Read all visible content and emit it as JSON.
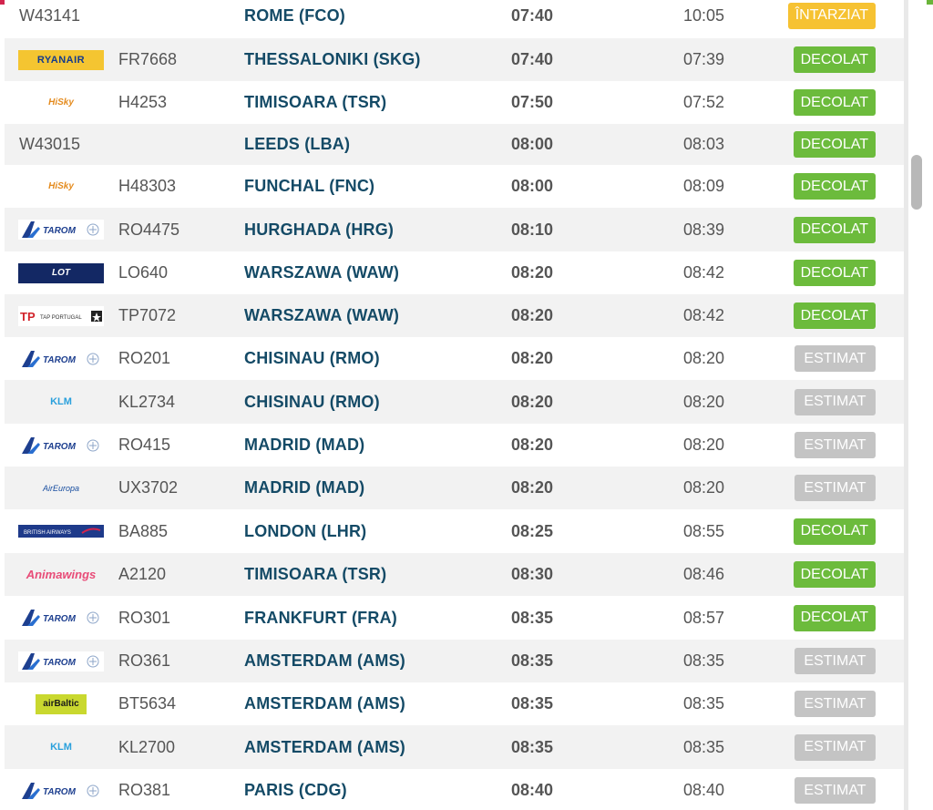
{
  "colors": {
    "topbar": [
      "#d2244d",
      "#8b2a82",
      "#6ab43a"
    ],
    "destination": "#144a66",
    "status_decolat": "#6cbb3c",
    "status_estimat": "#c4c4c4",
    "status_intarziat": "#f6c232"
  },
  "flights": [
    {
      "airline_icon": "none",
      "airline_text": "",
      "flight": "W43141",
      "destination": "ROME (FCO)",
      "scheduled": "07:40",
      "estimated": "10:05",
      "status": "ÎNTARZIAT",
      "status_type": "intarziat"
    },
    {
      "airline_icon": "ryanair-logo-icon",
      "airline_text": "RYANAIR",
      "flight": "FR7668",
      "destination": "THESSALONIKI (SKG)",
      "scheduled": "07:40",
      "estimated": "07:39",
      "status": "DECOLAT",
      "status_type": "decolat"
    },
    {
      "airline_icon": "hisky-logo-icon",
      "airline_text": "HiSky",
      "flight": "H4253",
      "destination": "TIMISOARA (TSR)",
      "scheduled": "07:50",
      "estimated": "07:52",
      "status": "DECOLAT",
      "status_type": "decolat"
    },
    {
      "airline_icon": "none",
      "airline_text": "",
      "flight": "W43015",
      "destination": "LEEDS (LBA)",
      "scheduled": "08:00",
      "estimated": "08:03",
      "status": "DECOLAT",
      "status_type": "decolat"
    },
    {
      "airline_icon": "hisky-logo-icon",
      "airline_text": "HiSky",
      "flight": "H48303",
      "destination": "FUNCHAL (FNC)",
      "scheduled": "08:00",
      "estimated": "08:09",
      "status": "DECOLAT",
      "status_type": "decolat"
    },
    {
      "airline_icon": "tarom-logo-icon",
      "airline_text": "TAROM",
      "flight": "RO4475",
      "destination": "HURGHADA (HRG)",
      "scheduled": "08:10",
      "estimated": "08:39",
      "status": "DECOLAT",
      "status_type": "decolat"
    },
    {
      "airline_icon": "lot-logo-icon",
      "airline_text": "LOT",
      "flight": "LO640",
      "destination": "WARSZAWA (WAW)",
      "scheduled": "08:20",
      "estimated": "08:42",
      "status": "DECOLAT",
      "status_type": "decolat"
    },
    {
      "airline_icon": "tap-logo-icon",
      "airline_text": "TAP PORTUGAL",
      "flight": "TP7072",
      "destination": "WARSZAWA (WAW)",
      "scheduled": "08:20",
      "estimated": "08:42",
      "status": "DECOLAT",
      "status_type": "decolat"
    },
    {
      "airline_icon": "tarom-logo-icon",
      "airline_text": "TAROM",
      "flight": "RO201",
      "destination": "CHISINAU (RMO)",
      "scheduled": "08:20",
      "estimated": "08:20",
      "status": "ESTIMAT",
      "status_type": "estimat"
    },
    {
      "airline_icon": "klm-logo-icon",
      "airline_text": "KLM",
      "flight": "KL2734",
      "destination": "CHISINAU (RMO)",
      "scheduled": "08:20",
      "estimated": "08:20",
      "status": "ESTIMAT",
      "status_type": "estimat"
    },
    {
      "airline_icon": "tarom-logo-icon",
      "airline_text": "TAROM",
      "flight": "RO415",
      "destination": "MADRID (MAD)",
      "scheduled": "08:20",
      "estimated": "08:20",
      "status": "ESTIMAT",
      "status_type": "estimat"
    },
    {
      "airline_icon": "aireuropa-logo-icon",
      "airline_text": "AirEuropa",
      "flight": "UX3702",
      "destination": "MADRID (MAD)",
      "scheduled": "08:20",
      "estimated": "08:20",
      "status": "ESTIMAT",
      "status_type": "estimat"
    },
    {
      "airline_icon": "british-airways-logo-icon",
      "airline_text": "",
      "flight": "BA885",
      "destination": "LONDON (LHR)",
      "scheduled": "08:25",
      "estimated": "08:55",
      "status": "DECOLAT",
      "status_type": "decolat"
    },
    {
      "airline_icon": "animawings-logo-icon",
      "airline_text": "Animawings",
      "flight": "A2120",
      "destination": "TIMISOARA (TSR)",
      "scheduled": "08:30",
      "estimated": "08:46",
      "status": "DECOLAT",
      "status_type": "decolat"
    },
    {
      "airline_icon": "tarom-logo-icon",
      "airline_text": "TAROM",
      "flight": "RO301",
      "destination": "FRANKFURT (FRA)",
      "scheduled": "08:35",
      "estimated": "08:57",
      "status": "DECOLAT",
      "status_type": "decolat"
    },
    {
      "airline_icon": "tarom-logo-icon",
      "airline_text": "TAROM",
      "flight": "RO361",
      "destination": "AMSTERDAM (AMS)",
      "scheduled": "08:35",
      "estimated": "08:35",
      "status": "ESTIMAT",
      "status_type": "estimat"
    },
    {
      "airline_icon": "airbaltic-logo-icon",
      "airline_text": "airBaltic",
      "flight": "BT5634",
      "destination": "AMSTERDAM (AMS)",
      "scheduled": "08:35",
      "estimated": "08:35",
      "status": "ESTIMAT",
      "status_type": "estimat"
    },
    {
      "airline_icon": "klm-logo-icon",
      "airline_text": "KLM",
      "flight": "KL2700",
      "destination": "AMSTERDAM (AMS)",
      "scheduled": "08:35",
      "estimated": "08:35",
      "status": "ESTIMAT",
      "status_type": "estimat"
    },
    {
      "airline_icon": "tarom-logo-icon",
      "airline_text": "TAROM",
      "flight": "RO381",
      "destination": "PARIS (CDG)",
      "scheduled": "08:40",
      "estimated": "08:40",
      "status": "ESTIMAT",
      "status_type": "estimat"
    }
  ]
}
